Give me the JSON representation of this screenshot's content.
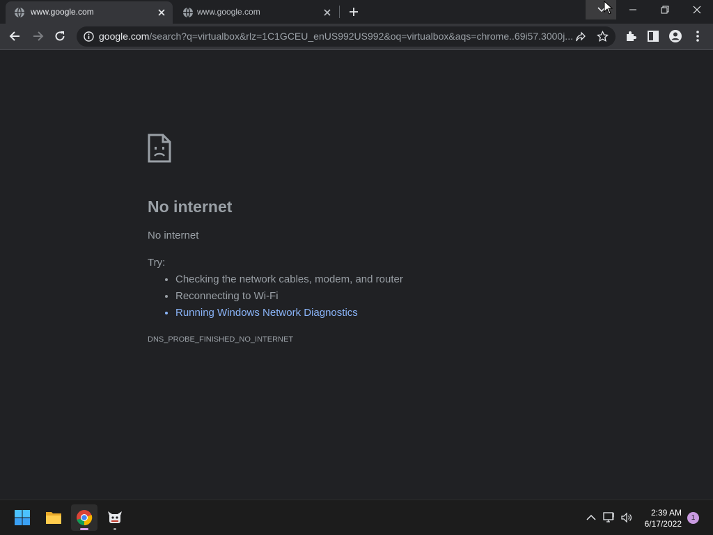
{
  "browser": {
    "tabs": [
      {
        "title": "www.google.com",
        "active": true
      },
      {
        "title": "www.google.com",
        "active": false
      }
    ],
    "url_host": "google.com",
    "url_rest": "/search?q=virtualbox&rlz=1C1GCEU_enUS992US992&oq=virtualbox&aqs=chrome..69i57.3000j..."
  },
  "error_page": {
    "heading": "No internet",
    "subtitle": "No internet",
    "try_label": "Try:",
    "suggestions": [
      "Checking the network cables, modem, and router",
      "Reconnecting to Wi-Fi",
      "Running Windows Network Diagnostics"
    ],
    "error_code": "DNS_PROBE_FINISHED_NO_INTERNET"
  },
  "taskbar": {
    "time": "2:39 AM",
    "date": "6/17/2022",
    "notification_count": "1"
  },
  "colors": {
    "background": "#202124",
    "toolbar": "#35363a",
    "link": "#8ab4f8",
    "text": "#9aa0a6"
  }
}
